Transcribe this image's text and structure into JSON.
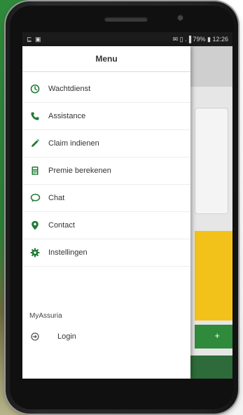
{
  "status_bar": {
    "left_icons": "⊑ ▣",
    "right_text": "✉ ▯ .▐ 79% ▮ 12:26"
  },
  "drawer": {
    "title": "Menu",
    "items": [
      {
        "icon": "clock-icon",
        "label": "Wachtdienst"
      },
      {
        "icon": "phone-icon",
        "label": "Assistance"
      },
      {
        "icon": "pencil-icon",
        "label": "Claim indienen"
      },
      {
        "icon": "calculator-icon",
        "label": "Premie berekenen"
      },
      {
        "icon": "chat-icon",
        "label": "Chat"
      },
      {
        "icon": "location-pin-icon",
        "label": "Contact"
      },
      {
        "icon": "gear-icon",
        "label": "Instellingen"
      }
    ],
    "section_label": "MyAssuria",
    "login_label": "Login"
  },
  "background_app": {
    "button_glyph": "+"
  },
  "colors": {
    "accent_green": "#2f8a3c",
    "icon_green": "#1f7a35",
    "card_yellow": "#f2c21b"
  }
}
